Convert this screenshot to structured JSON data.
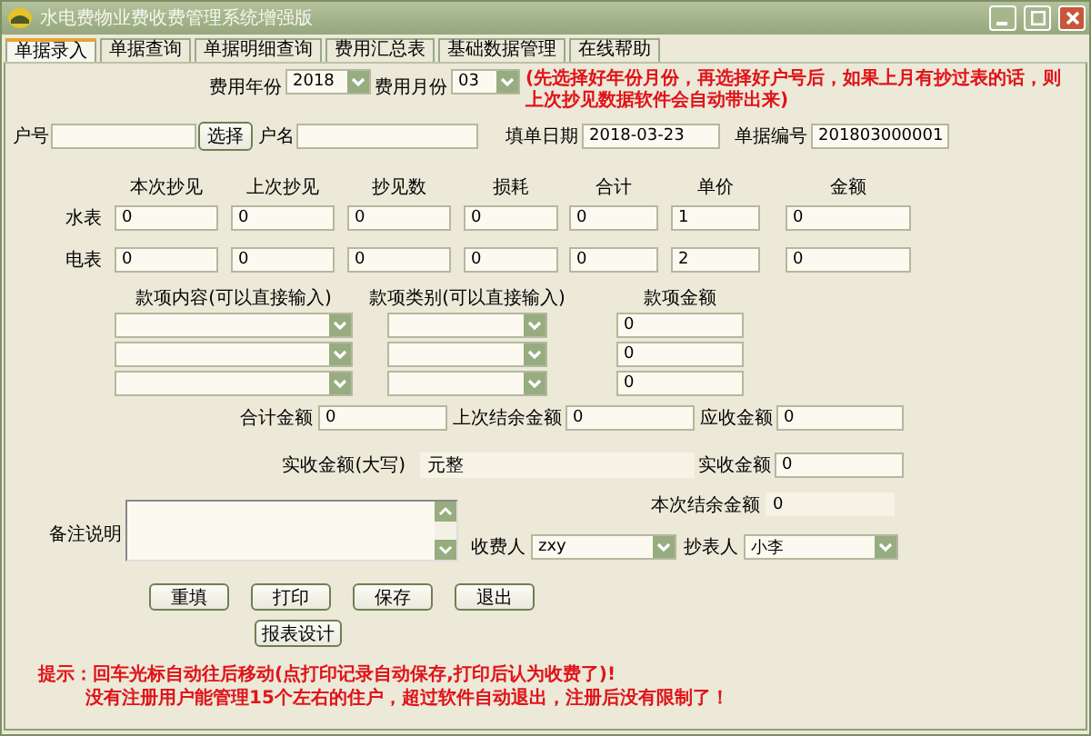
{
  "window": {
    "title": "水电费物业费收费管理系统增强版"
  },
  "tabs": [
    {
      "label": "单据录入",
      "selected": true
    },
    {
      "label": "单据查询",
      "selected": false
    },
    {
      "label": "单据明细查询",
      "selected": false
    },
    {
      "label": "费用汇总表",
      "selected": false
    },
    {
      "label": "基础数据管理",
      "selected": false
    },
    {
      "label": "在线帮助",
      "selected": false
    }
  ],
  "period": {
    "year_label": "费用年份",
    "year": "2018",
    "month_label": "费用月份",
    "month": "03",
    "note": "(先选择好年份月份，再选择好户号后，如果上月有抄过表的话，则上次抄见数据软件会自动带出来)"
  },
  "account": {
    "number_label": "户号",
    "select_button": "选择",
    "name_label": "户名",
    "date_label": "填单日期",
    "date": "2018-03-23",
    "bill_no_label": "单据编号",
    "bill_no": "201803000001"
  },
  "meters": {
    "columns": [
      "本次抄见",
      "上次抄见",
      "抄见数",
      "损耗",
      "合计",
      "单价",
      "金额"
    ],
    "rows": [
      {
        "label": "水表",
        "values": [
          "0",
          "0",
          "0",
          "0",
          "0",
          "1",
          "0"
        ]
      },
      {
        "label": "电表",
        "values": [
          "0",
          "0",
          "0",
          "0",
          "0",
          "2",
          "0"
        ]
      }
    ]
  },
  "charges": {
    "columns": [
      "款项内容(可以直接输入)",
      "款项类别(可以直接输入)",
      "款项金额"
    ],
    "rows": [
      {
        "amount": "0"
      },
      {
        "amount": "0"
      },
      {
        "amount": "0"
      }
    ]
  },
  "summary": {
    "total_label": "合计金额",
    "total": "0",
    "previous_balance_label": "上次结余金额",
    "previous_balance": "0",
    "receivable_label": "应收金额",
    "receivable": "0",
    "received_words_label": "实收金额(大写)",
    "received_words": "元整",
    "received_label": "实收金额",
    "received": "0",
    "balance_label": "本次结余金额",
    "balance": "0"
  },
  "remark": {
    "label": "备注说明"
  },
  "people": {
    "collector_label": "收费人",
    "collector": "zxy",
    "reader_label": "抄表人",
    "reader": "小李"
  },
  "buttons": [
    "重填",
    "打印",
    "保存",
    "退出"
  ],
  "report_button": "报表设计",
  "tips": [
    "提示：回车光标自动往后移动(点打印记录自动保存,打印后认为收费了)!",
    "没有注册用户能管理15个左右的住户，超过软件自动退出，注册后没有限制了！"
  ]
}
